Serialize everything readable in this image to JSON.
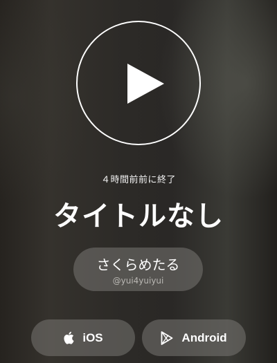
{
  "player": {
    "play_icon": "play-icon"
  },
  "broadcast": {
    "status": "４時間前前に終了",
    "title": "タイトルなし"
  },
  "user": {
    "name": "さくらめたる",
    "handle": "@yui4yuiyui"
  },
  "stores": {
    "ios_label": "iOS",
    "ios_icon": "apple-icon",
    "android_label": "Android",
    "android_icon": "google-play-icon"
  },
  "colors": {
    "text": "#ffffff",
    "handle_text": "#b9b7b3",
    "pill_background": "rgba(120,118,114,0.55)"
  }
}
